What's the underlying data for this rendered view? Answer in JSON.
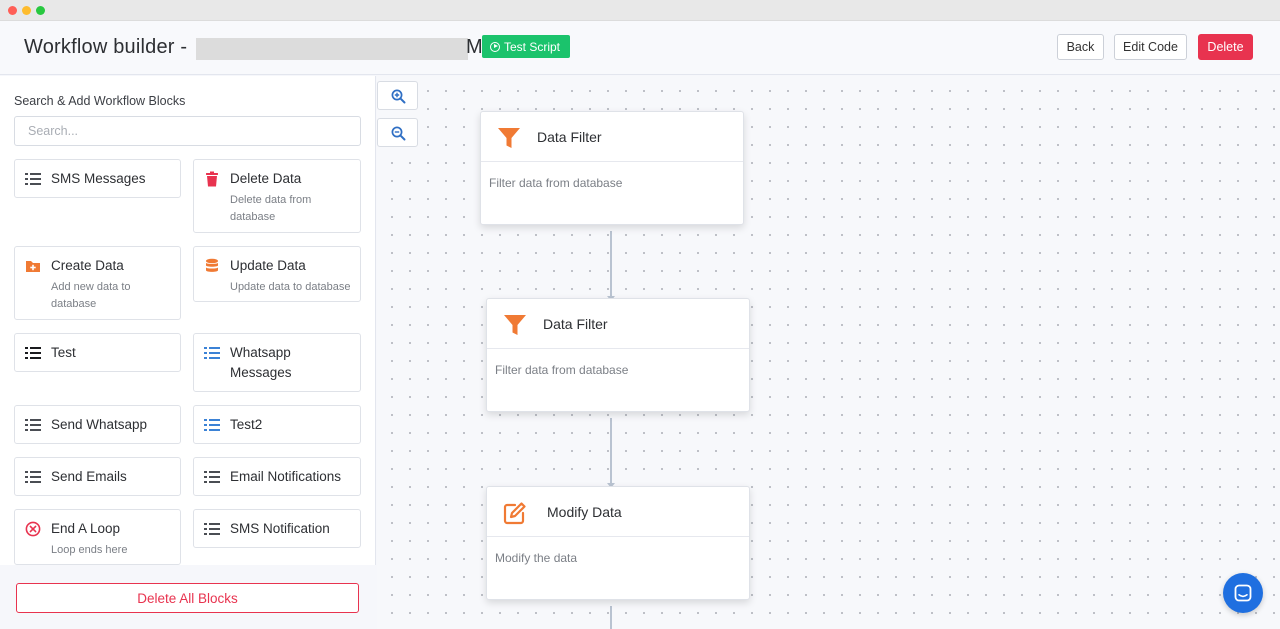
{
  "header": {
    "title": "Workflow builder -",
    "title_suffix": "M",
    "test_script_label": "Test Script",
    "back_label": "Back",
    "edit_code_label": "Edit Code",
    "delete_label": "Delete"
  },
  "sidebar": {
    "heading": "Search & Add Workflow Blocks",
    "search_placeholder": "Search...",
    "blocks": [
      {
        "title": "SMS Messages",
        "desc": "",
        "icon": "list-icon"
      },
      {
        "title": "Delete Data",
        "desc": "Delete data from database",
        "icon": "trash-icon"
      },
      {
        "title": "Create Data",
        "desc": "Add new data to database",
        "icon": "folder-plus-icon"
      },
      {
        "title": "Update Data",
        "desc": "Update data to database",
        "icon": "database-icon"
      },
      {
        "title": "Test",
        "desc": "",
        "icon": "list-icon"
      },
      {
        "title": "Whatsapp Messages",
        "desc": "",
        "icon": "list-icon"
      },
      {
        "title": "Send Whatsapp",
        "desc": "",
        "icon": "list-icon"
      },
      {
        "title": "Test2",
        "desc": "",
        "icon": "list-icon"
      },
      {
        "title": "Send Emails",
        "desc": "",
        "icon": "list-icon"
      },
      {
        "title": "Email Notifications",
        "desc": "",
        "icon": "list-icon"
      },
      {
        "title": "End A Loop",
        "desc": "Loop ends here",
        "icon": "close-circle-icon"
      },
      {
        "title": "SMS Notification",
        "desc": "",
        "icon": "list-icon"
      }
    ],
    "delete_all_label": "Delete All Blocks"
  },
  "canvas": {
    "nodes": [
      {
        "title": "Data Filter",
        "desc": "Filter data from database",
        "icon": "funnel-icon"
      },
      {
        "title": "Data Filter",
        "desc": "Filter data from database",
        "icon": "funnel-icon"
      },
      {
        "title": "Modify Data",
        "desc": "Modify the data",
        "icon": "edit-icon"
      }
    ]
  },
  "colors": {
    "accent_green": "#1bc36c",
    "danger_red": "#e8334f",
    "node_icon_orange": "#f07a34",
    "list_blue": "#3b82d6",
    "chat_blue": "#1f6fe0"
  }
}
